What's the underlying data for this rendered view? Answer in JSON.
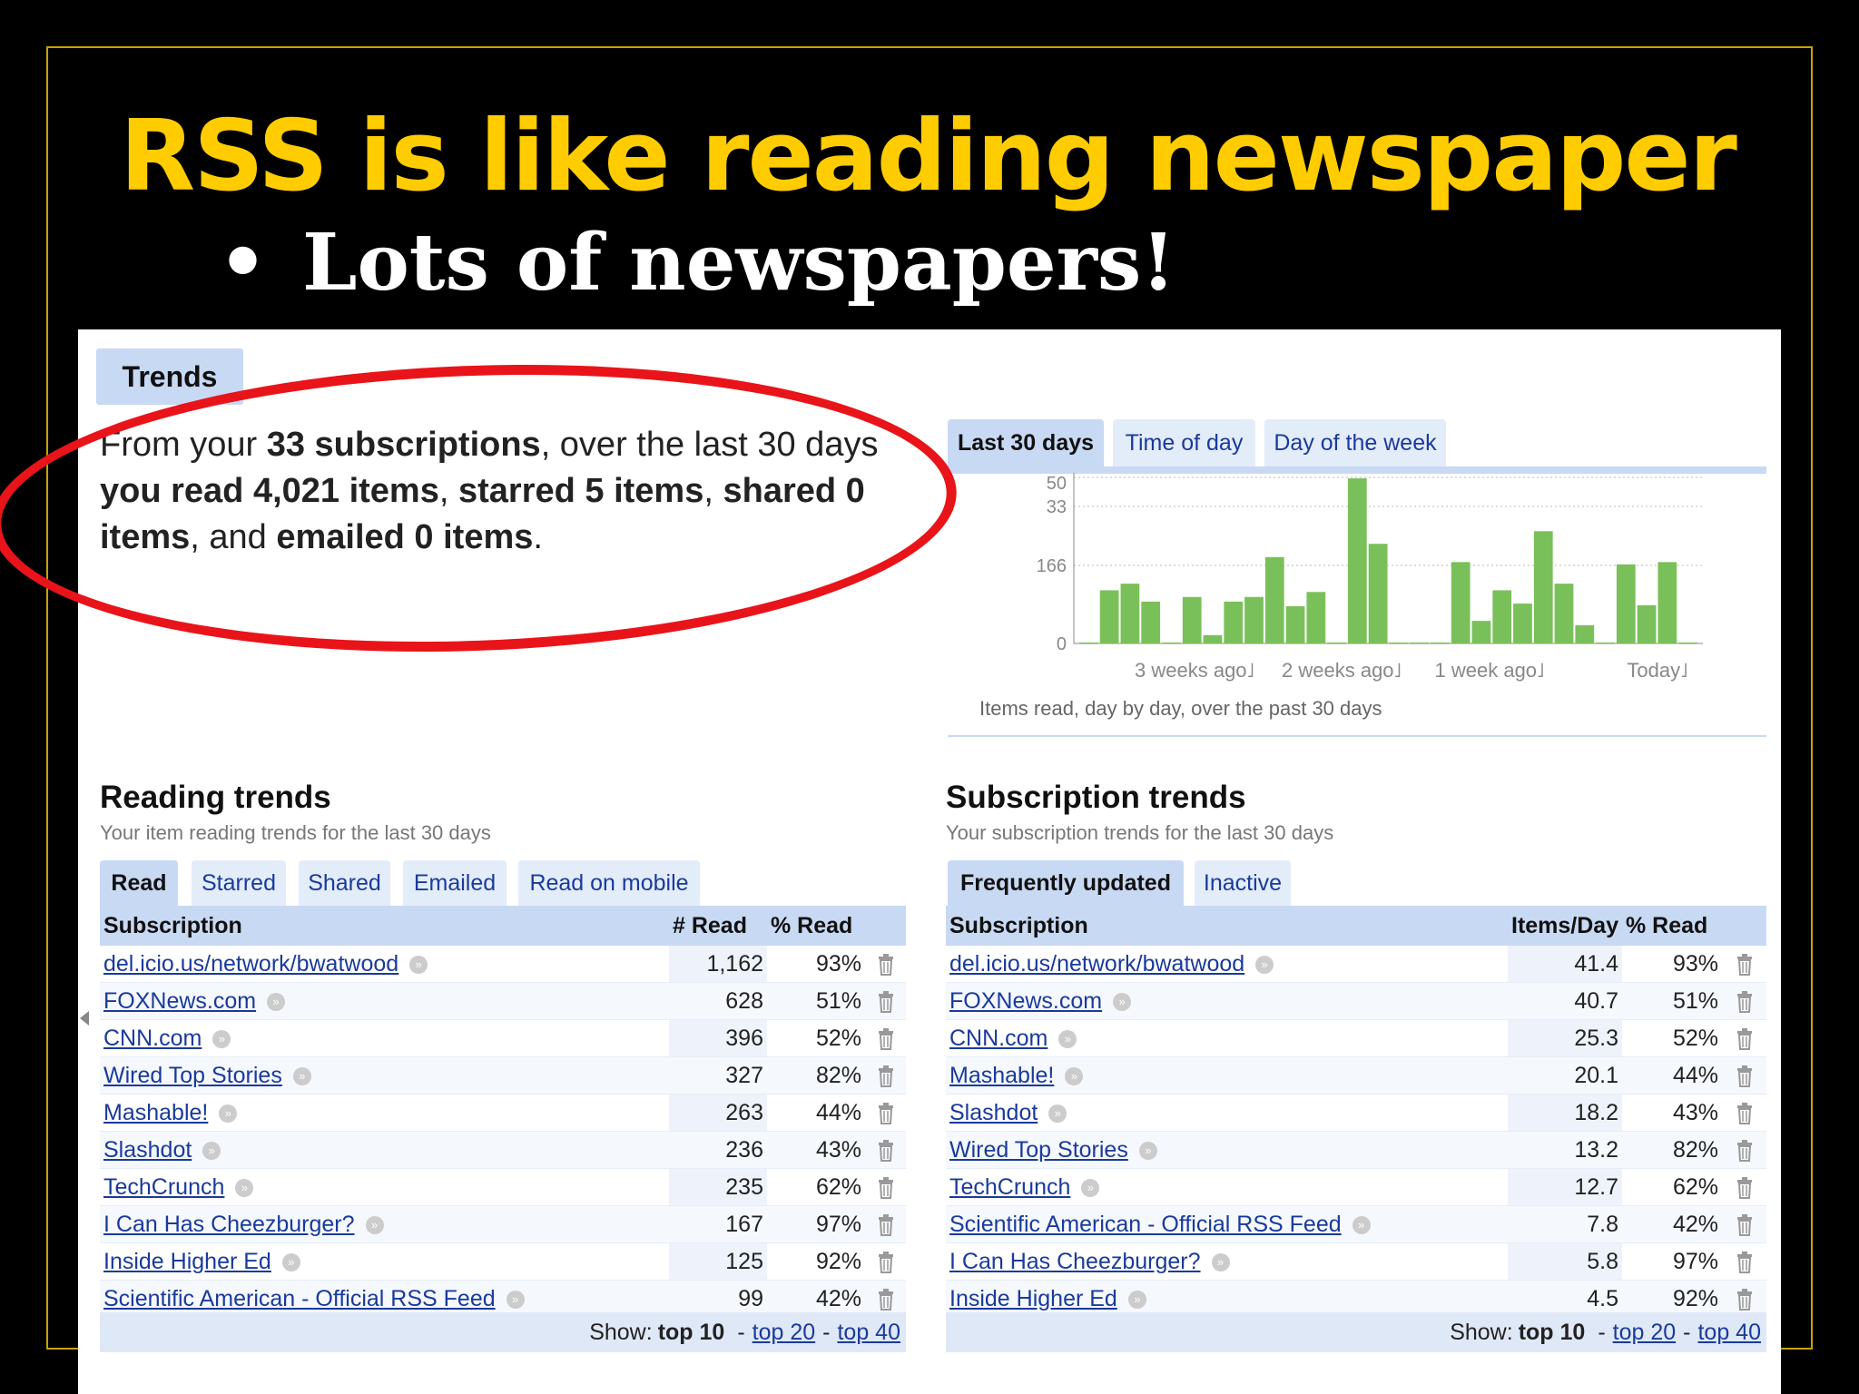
{
  "slide": {
    "title": "RSS is like reading newspaper",
    "bullet_symbol": "•",
    "bullet": "Lots of newspapers!"
  },
  "trends": {
    "tab_label": "Trends",
    "summary": {
      "p1": "From your ",
      "b1": "33 subscriptions",
      "p2": ", over the last 30 days ",
      "b2": "you read 4,021 items",
      "p3": ", ",
      "b3": "starred 5 items",
      "p4": ", ",
      "b4": "shared 0 items",
      "p5": ", and ",
      "b5": "emailed 0 items",
      "p6": "."
    }
  },
  "chart_tabs": [
    "Last 30 days",
    "Time of day",
    "Day of the week"
  ],
  "chart_data": {
    "type": "bar",
    "title": "",
    "caption": "Items read, day by day, over the past 30 days",
    "y_ticks": [
      "0",
      "166",
      "33",
      "50"
    ],
    "x_ticks": [
      "3 weeks ago˩",
      "2 weeks ago˩",
      "1 week ago˩",
      "Today˩"
    ],
    "values": [
      3,
      160,
      180,
      126,
      3,
      140,
      25,
      126,
      140,
      260,
      112,
      155,
      3,
      497,
      300,
      3,
      3,
      3,
      245,
      68,
      160,
      120,
      338,
      180,
      55,
      3,
      238,
      115,
      245,
      3
    ],
    "ylim": [
      0,
      500
    ],
    "grid": true,
    "colors": {
      "bar": "#7ac05a"
    }
  },
  "reading": {
    "title": "Reading trends",
    "subtitle": "Your item reading trends for the last 30 days",
    "tabs": [
      "Read",
      "Starred",
      "Shared",
      "Emailed",
      "Read on mobile"
    ],
    "headers": [
      "Subscription",
      "# Read",
      "% Read"
    ],
    "rows": [
      {
        "name": "del.icio.us/network/bwatwood",
        "count": "1,162",
        "pct": "93%"
      },
      {
        "name": "FOXNews.com",
        "count": "628",
        "pct": "51%"
      },
      {
        "name": "CNN.com",
        "count": "396",
        "pct": "52%"
      },
      {
        "name": "Wired Top Stories",
        "count": "327",
        "pct": "82%"
      },
      {
        "name": "Mashable!",
        "count": "263",
        "pct": "44%"
      },
      {
        "name": "Slashdot",
        "count": "236",
        "pct": "43%"
      },
      {
        "name": "TechCrunch",
        "count": "235",
        "pct": "62%"
      },
      {
        "name": "I Can Has Cheezburger?",
        "count": "167",
        "pct": "97%"
      },
      {
        "name": "Inside Higher Ed",
        "count": "125",
        "pct": "92%"
      },
      {
        "name": "Scientific American - Official RSS Feed",
        "count": "99",
        "pct": "42%"
      }
    ],
    "footer": {
      "show": "Show:",
      "top10": "top 10",
      "dash": "-",
      "top20": "top 20",
      "top40": "top 40"
    }
  },
  "subscription": {
    "title": "Subscription trends",
    "subtitle": "Your subscription trends for the last 30 days",
    "tabs": [
      "Frequently updated",
      "Inactive"
    ],
    "headers": [
      "Subscription",
      "Items/Day",
      "% Read"
    ],
    "rows": [
      {
        "name": "del.icio.us/network/bwatwood",
        "count": "41.4",
        "pct": "93%"
      },
      {
        "name": "FOXNews.com",
        "count": "40.7",
        "pct": "51%"
      },
      {
        "name": "CNN.com",
        "count": "25.3",
        "pct": "52%"
      },
      {
        "name": "Mashable!",
        "count": "20.1",
        "pct": "44%"
      },
      {
        "name": "Slashdot",
        "count": "18.2",
        "pct": "43%"
      },
      {
        "name": "Wired Top Stories",
        "count": "13.2",
        "pct": "82%"
      },
      {
        "name": "TechCrunch",
        "count": "12.7",
        "pct": "62%"
      },
      {
        "name": "Scientific American - Official RSS Feed",
        "count": "7.8",
        "pct": "42%"
      },
      {
        "name": "I Can Has Cheezburger?",
        "count": "5.8",
        "pct": "97%"
      },
      {
        "name": "Inside Higher Ed",
        "count": "4.5",
        "pct": "92%"
      }
    ],
    "footer": {
      "show": "Show:",
      "top10": "top 10",
      "dash": "-",
      "top20": "top 20",
      "top40": "top 40"
    }
  },
  "icons": {
    "more": "more-arrow-icon",
    "delete": "trash-icon",
    "highlight": "red-ellipse-annotation"
  }
}
